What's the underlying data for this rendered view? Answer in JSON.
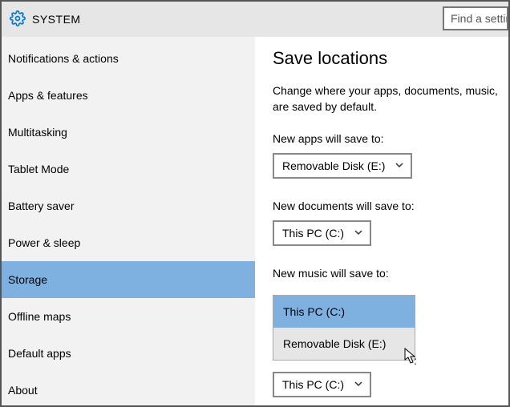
{
  "header": {
    "title": "SYSTEM",
    "search_placeholder": "Find a setting"
  },
  "sidebar": {
    "items": [
      {
        "label": "Notifications & actions",
        "selected": false
      },
      {
        "label": "Apps & features",
        "selected": false
      },
      {
        "label": "Multitasking",
        "selected": false
      },
      {
        "label": "Tablet Mode",
        "selected": false
      },
      {
        "label": "Battery saver",
        "selected": false
      },
      {
        "label": "Power & sleep",
        "selected": false
      },
      {
        "label": "Storage",
        "selected": true
      },
      {
        "label": "Offline maps",
        "selected": false
      },
      {
        "label": "Default apps",
        "selected": false
      },
      {
        "label": "About",
        "selected": false
      }
    ]
  },
  "main": {
    "title": "Save locations",
    "description_line1": "Change where your apps, documents, music,",
    "description_line2": "are saved by default.",
    "sections": [
      {
        "label": "New apps will save to:",
        "value": "Removable Disk (E:)"
      },
      {
        "label": "New documents will save to:",
        "value": "This PC (C:)"
      },
      {
        "label": "New music will save to:",
        "value": "This PC (C:)"
      }
    ],
    "music_dropdown_options": [
      {
        "label": "This PC (C:)",
        "selected": true
      },
      {
        "label": "Removable Disk (E:)",
        "selected": false
      }
    ],
    "extra_dropdown_value": "This PC (C:)"
  },
  "colors": {
    "selection": "#7fb1e0",
    "header_bg": "#e6e6e6",
    "sidebar_bg": "#f2f2f2"
  }
}
